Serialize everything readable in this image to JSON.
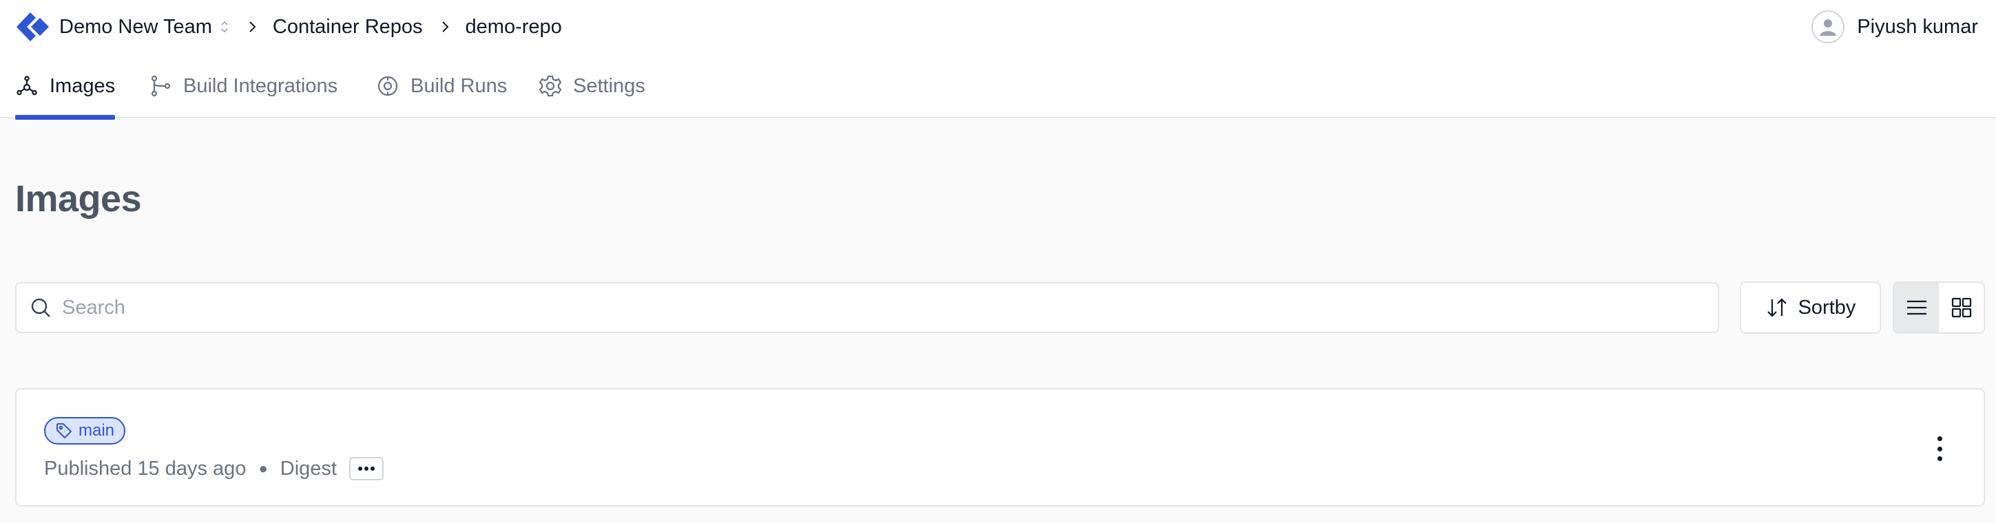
{
  "header": {
    "team": "Demo New Team",
    "breadcrumbs": [
      "Container Repos",
      "demo-repo"
    ],
    "user_name": "Piyush kumar"
  },
  "tabs": [
    {
      "label": "Images",
      "icon": "images-icon",
      "active": true
    },
    {
      "label": "Build Integrations",
      "icon": "git-branch-icon",
      "active": false
    },
    {
      "label": "Build Runs",
      "icon": "build-runs-icon",
      "active": false
    },
    {
      "label": "Settings",
      "icon": "gear-icon",
      "active": false
    }
  ],
  "page": {
    "title": "Images",
    "search_placeholder": "Search",
    "search_value": "",
    "sort_label": "Sortby",
    "view_mode": "list"
  },
  "images": [
    {
      "tag": "main",
      "published": "Published 15 days ago",
      "digest_label": "Digest"
    }
  ],
  "colors": {
    "accent": "#2f55d4",
    "tag_bg": "#dbe4ff",
    "background": "#fafafa"
  }
}
